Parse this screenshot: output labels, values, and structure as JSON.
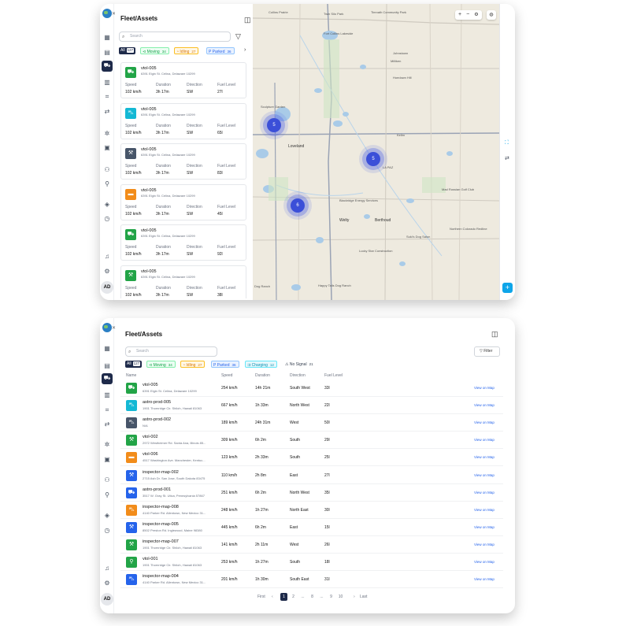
{
  "colors": {
    "navy": "#1e2a4a",
    "green": "#16a34a",
    "cyan": "#06b6d4",
    "orange": "#f59e0b",
    "blue": "#2563eb",
    "dark": "#475569",
    "link": "#2563eb"
  },
  "window1": {
    "title": "Fleet/Assets",
    "search_placeholder": "Search",
    "chips": [
      {
        "label": "All",
        "count": "127"
      },
      {
        "label": "Moving",
        "count": "34"
      },
      {
        "label": "Idling",
        "count": "27"
      },
      {
        "label": "Parked",
        "count": "36"
      }
    ],
    "card_labels": {
      "speed": "Speed",
      "duration": "Duration",
      "direction": "Direction",
      "fuel": "Fuel Level"
    },
    "cards": [
      {
        "name": "vtol-005",
        "address": "6391 Elgin St. Celina, Delaware 10299",
        "speed": "102 km/h",
        "duration": "3h 17m",
        "direction": "SW",
        "fuel": "27l",
        "color": "#22a447",
        "icon": "truck-icon"
      },
      {
        "name": "vtol-005",
        "address": "6391 Elgin St. Celina, Delaware 10299",
        "speed": "102 km/h",
        "duration": "3h 17m",
        "direction": "SW",
        "fuel": "65l",
        "color": "#14b8d4",
        "icon": "car-icon"
      },
      {
        "name": "vtol-005",
        "address": "6391 Elgin St. Celina, Delaware 10299",
        "speed": "102 km/h",
        "duration": "3h 17m",
        "direction": "SW",
        "fuel": "83l",
        "color": "#475569",
        "icon": "forklift-icon"
      },
      {
        "name": "vtol-005",
        "address": "6391 Elgin St. Celina, Delaware 10299",
        "speed": "102 km/h",
        "duration": "3h 17m",
        "direction": "SW",
        "fuel": "45l",
        "color": "#f28c1a",
        "icon": "bus-icon"
      },
      {
        "name": "vtol-005",
        "address": "6391 Elgin St. Celina, Delaware 10299",
        "speed": "102 km/h",
        "duration": "3h 17m",
        "direction": "SW",
        "fuel": "92l",
        "color": "#22a447",
        "icon": "truck-icon"
      },
      {
        "name": "vtol-005",
        "address": "6391 Elgin St. Celina, Delaware 10299",
        "speed": "102 km/h",
        "duration": "3h 17m",
        "direction": "SW",
        "fuel": "38l",
        "color": "#22a447",
        "icon": "forklift-icon"
      }
    ],
    "map": {
      "clusters": [
        "5",
        "5",
        "6"
      ],
      "labels": [
        "Twin Silo Park",
        "Timnath Community Park",
        "Collins Prairie",
        "Fort Collins Lakeside",
        "Loveland",
        "Kelim",
        "LA PAZ",
        "Mad Russian Golf Club",
        "Northern Colorado Redline",
        "Johnstown",
        "Milliken",
        "Welty",
        "Berthoud",
        "Hoedown Hill",
        "Suki's Dog Salon",
        "Lucky Star Construction",
        "Happy Tails Dog Ranch",
        "Sculpture Garden",
        "Blackridge Energy Services",
        "Dog Ranch"
      ]
    }
  },
  "window2": {
    "title": "Fleet/Assets",
    "search_placeholder": "Search",
    "filter_label": "Filter",
    "chips": [
      {
        "label": "All",
        "count": "127"
      },
      {
        "label": "Moving",
        "count": "34"
      },
      {
        "label": "Idling",
        "count": "27"
      },
      {
        "label": "Parked",
        "count": "36"
      },
      {
        "label": "Charging",
        "count": "12"
      },
      {
        "label": "No Signal",
        "count": "21"
      }
    ],
    "columns": [
      "Name",
      "Speed",
      "Duration",
      "Direction",
      "Fuel Level"
    ],
    "view_label": "View on Map",
    "rows": [
      {
        "name": "vtol-005",
        "address": "6391 Elgin St. Celina, Delaware 10299",
        "speed": "254 km/h",
        "duration": "14h 21m",
        "direction": "South West",
        "fuel": "33l",
        "color": "#22a447",
        "icon": "truck-icon"
      },
      {
        "name": "astro-prod-005",
        "address": "1901 Thornridge Cir. Shiloh, Hawaii 81063",
        "speed": "667 km/h",
        "duration": "1h 33m",
        "direction": "North West",
        "fuel": "22l",
        "color": "#14b8d4",
        "icon": "car-icon"
      },
      {
        "name": "astro-prod-002",
        "address": "N/A",
        "speed": "189 km/h",
        "duration": "24h 31m",
        "direction": "West",
        "fuel": "50l",
        "color": "#475569",
        "icon": "car-icon"
      },
      {
        "name": "vtol-002",
        "address": "2972 Westheimer Rd. Santa Ana, Illinois 85...",
        "speed": "309 km/h",
        "duration": "6h 2m",
        "direction": "South",
        "fuel": "29l",
        "color": "#22a447",
        "icon": "forklift-icon"
      },
      {
        "name": "vtol-006",
        "address": "4517 Washington Ave. Manchester, Kentuc...",
        "speed": "123 km/h",
        "duration": "2h 33m",
        "direction": "South",
        "fuel": "25l",
        "color": "#f28c1a",
        "icon": "bus-icon"
      },
      {
        "name": "inspector-map-002",
        "address": "2715 Ash Dr. San Jose, South Dakota 83475",
        "speed": "110 km/h",
        "duration": "2h 8m",
        "direction": "East",
        "fuel": "27l",
        "color": "#2563eb",
        "icon": "forklift-icon"
      },
      {
        "name": "astro-prod-001",
        "address": "3517 W. Gray St. Utica, Pennsylvania 57867",
        "speed": "251 km/h",
        "duration": "6h 2m",
        "direction": "North West",
        "fuel": "35l",
        "color": "#2563eb",
        "icon": "truck-icon"
      },
      {
        "name": "inspector-map-008",
        "address": "4140 Parker Rd. Allentown, New Mexico 31...",
        "speed": "248 km/h",
        "duration": "1h 27m",
        "direction": "North East",
        "fuel": "30l",
        "color": "#f28c1a",
        "icon": "car-icon"
      },
      {
        "name": "inspector-map-005",
        "address": "8502 Preston Rd. Inglewood, Maine 98380",
        "speed": "445 km/h",
        "duration": "6h 2m",
        "direction": "East",
        "fuel": "15l",
        "color": "#2563eb",
        "icon": "forklift-icon"
      },
      {
        "name": "inspector-map-007",
        "address": "1901 Thornridge Cir. Shiloh, Hawaii 81063",
        "speed": "141 km/h",
        "duration": "2h 11m",
        "direction": "West",
        "fuel": "26l",
        "color": "#22a447",
        "icon": "forklift-icon"
      },
      {
        "name": "vtol-001",
        "address": "1901 Thornridge Cir. Shiloh, Hawaii 81063",
        "speed": "253 km/h",
        "duration": "1h 27m",
        "direction": "South",
        "fuel": "18l",
        "color": "#22a447",
        "icon": "bike-icon"
      },
      {
        "name": "inspector-map-004",
        "address": "4140 Parker Rd. Allentown, New Mexico 31...",
        "speed": "201 km/h",
        "duration": "1h 30m",
        "direction": "South East",
        "fuel": "31l",
        "color": "#2563eb",
        "icon": "car-icon"
      }
    ],
    "pagination": {
      "first": "First",
      "last": "Last",
      "pages": [
        "1",
        "2",
        "...",
        "8",
        "...",
        "9",
        "10"
      ],
      "current": "1"
    }
  },
  "rail": {
    "avatar": "AD"
  }
}
